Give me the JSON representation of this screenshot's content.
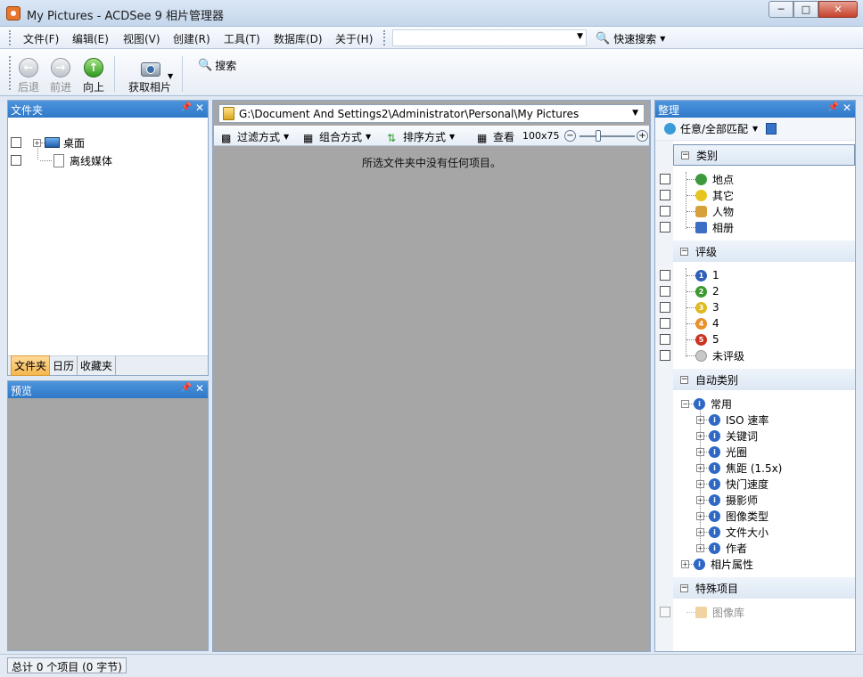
{
  "window": {
    "title": "My Pictures - ACDSee 9 相片管理器"
  },
  "menu": {
    "items": [
      "文件(F)",
      "编辑(E)",
      "视图(V)",
      "创建(R)",
      "工具(T)",
      "数据库(D)",
      "关于(H)"
    ],
    "quick_search_label": "快速搜索"
  },
  "toolbar": {
    "back_label": "后退",
    "forward_label": "前进",
    "up_label": "向上",
    "acquire_label": "获取相片",
    "search_label": "搜索"
  },
  "folders_panel": {
    "title": "文件夹",
    "tree": [
      {
        "label": "桌面"
      },
      {
        "label": "离线媒体"
      }
    ],
    "tabs": [
      "文件夹",
      "日历",
      "收藏夹"
    ]
  },
  "preview_panel": {
    "title": "预览"
  },
  "file_list": {
    "path": "G:\\Document And Settings2\\Administrator\\Personal\\My Pictures",
    "filter_label": "过滤方式",
    "group_label": "组合方式",
    "sort_label": "排序方式",
    "view_label": "查看",
    "thumb_size": "100x75",
    "empty_message": "所选文件夹中没有任何项目。"
  },
  "organize_panel": {
    "title": "整理",
    "match_label": "任意/全部匹配",
    "categories": {
      "title": "类别",
      "items": [
        "地点",
        "其它",
        "人物",
        "相册"
      ]
    },
    "ratings": {
      "title": "评级",
      "items": [
        "1",
        "2",
        "3",
        "4",
        "5",
        "未评级"
      ]
    },
    "auto_categories": {
      "title": "自动类别",
      "common": "常用",
      "items": [
        "ISO 速率",
        "关键词",
        "光圈",
        "焦距 (1.5x)",
        "快门速度",
        "摄影师",
        "图像类型",
        "文件大小",
        "作者"
      ],
      "photo_props": "相片属性"
    },
    "special": {
      "title": "特殊项目",
      "first_item": "图像库"
    }
  },
  "status": {
    "text": "总计 0 个项目 (0 字节)"
  },
  "colors": {
    "panel_header": "#2e78c8",
    "file_area": "#a6a6a6",
    "active_tab": "#f5b74d"
  }
}
